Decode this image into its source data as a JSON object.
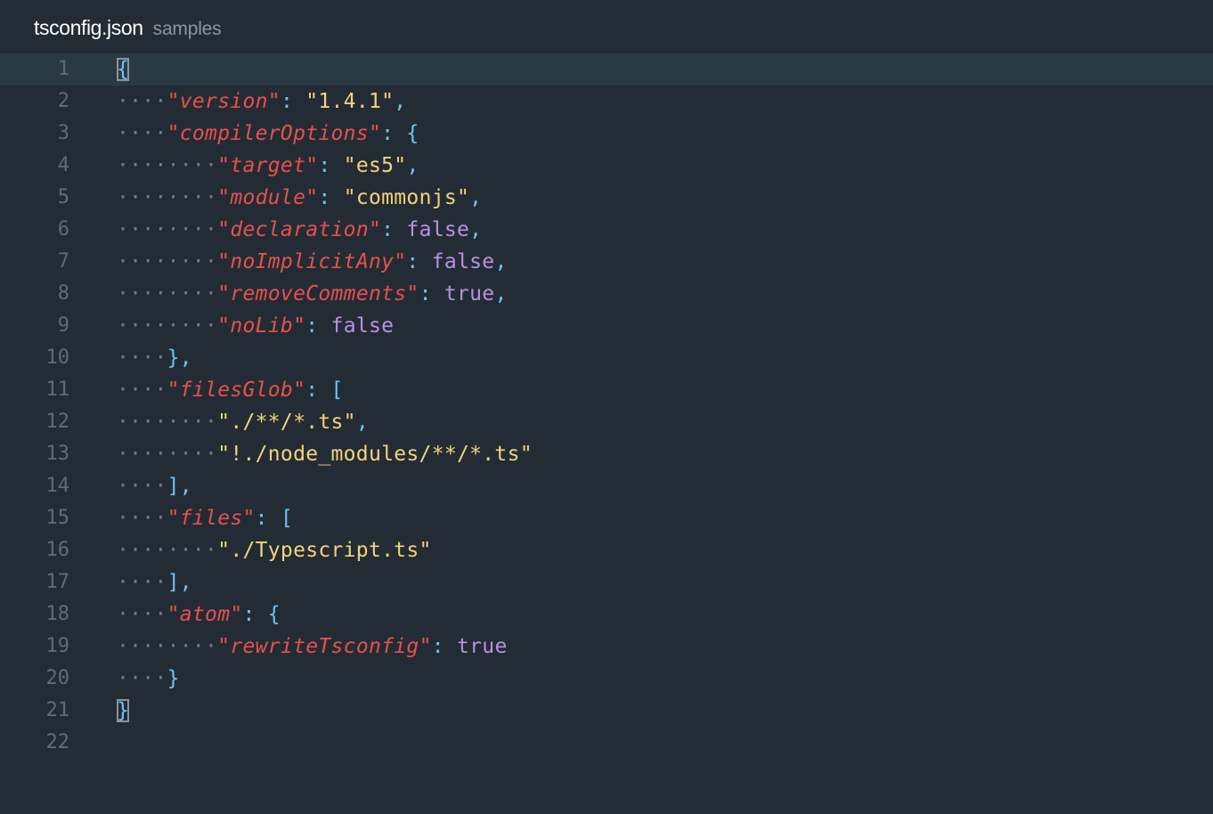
{
  "titlebar": {
    "file_name": "tsconfig.json",
    "project_name": "samples"
  },
  "editor": {
    "cursor_line": 1,
    "colors": {
      "background": "#232c35",
      "cursor_line": "#2a3a45",
      "key": "#e8504c",
      "string": "#f3d37a",
      "punctuation": "#6ec3f4",
      "boolean": "#b891e0",
      "line_number": "#5f6b76"
    },
    "lines": [
      {
        "number": "1"
      },
      {
        "number": "2",
        "indent": "····",
        "key": "version",
        "value": "\"1.4.1\"",
        "trail": ","
      },
      {
        "number": "3",
        "indent": "····",
        "key": "compilerOptions",
        "value": "{",
        "trail": ""
      },
      {
        "number": "4",
        "indent": "········",
        "key": "target",
        "value": "\"es5\"",
        "trail": ","
      },
      {
        "number": "5",
        "indent": "········",
        "key": "module",
        "value": "\"commonjs\"",
        "trail": ","
      },
      {
        "number": "6",
        "indent": "········",
        "key": "declaration",
        "value": "false",
        "trail": ","
      },
      {
        "number": "7",
        "indent": "········",
        "key": "noImplicitAny",
        "value": "false",
        "trail": ","
      },
      {
        "number": "8",
        "indent": "········",
        "key": "removeComments",
        "value": "true",
        "trail": ","
      },
      {
        "number": "9",
        "indent": "········",
        "key": "noLib",
        "value": "false",
        "trail": ""
      },
      {
        "number": "10",
        "indent": "····",
        "text": "},"
      },
      {
        "number": "11",
        "indent": "····",
        "key": "filesGlob",
        "value": "[",
        "trail": ""
      },
      {
        "number": "12",
        "indent": "········",
        "value": "\"./**/*.ts\"",
        "trail": ","
      },
      {
        "number": "13",
        "indent": "········",
        "value": "\"!./node_modules/**/*.ts\"",
        "trail": ""
      },
      {
        "number": "14",
        "indent": "····",
        "text": "],"
      },
      {
        "number": "15",
        "indent": "····",
        "key": "files",
        "value": "[",
        "trail": ""
      },
      {
        "number": "16",
        "indent": "········",
        "value": "\"./Typescript.ts\"",
        "trail": ""
      },
      {
        "number": "17",
        "indent": "····",
        "text": "],"
      },
      {
        "number": "18",
        "indent": "····",
        "key": "atom",
        "value": "{",
        "trail": ""
      },
      {
        "number": "19",
        "indent": "········",
        "key": "rewriteTsconfig",
        "value": "true",
        "trail": ""
      },
      {
        "number": "20",
        "indent": "····",
        "text": "}"
      },
      {
        "number": "21"
      },
      {
        "number": "22"
      }
    ],
    "open_brace": "{",
    "close_brace": "}"
  }
}
